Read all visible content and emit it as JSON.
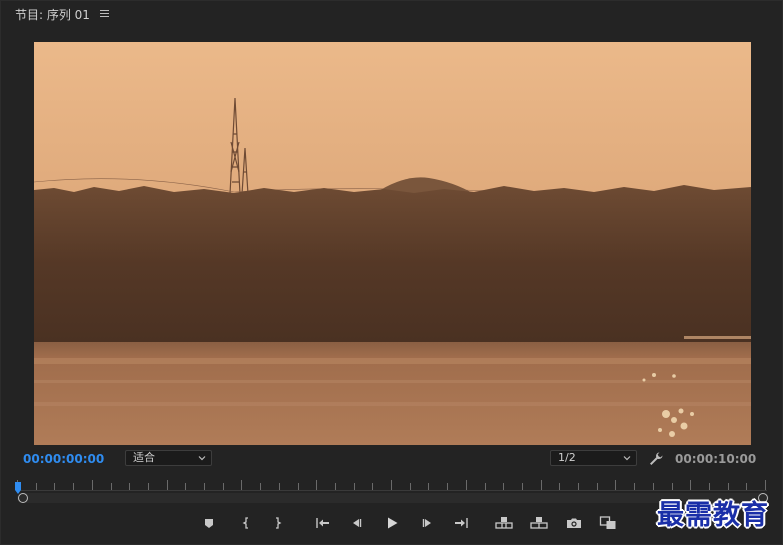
{
  "panel": {
    "title": "节目: 序列 01",
    "menu_icon": "hamburger-menu-icon"
  },
  "viewer": {
    "content": "video-frame",
    "palette": {
      "sky_top": "#e8b486",
      "sky_bottom": "#c88d63",
      "trees": "#5a3c2a",
      "water": "#a87452"
    }
  },
  "controls": {
    "current_timecode": "00:00:00:00",
    "zoom_level": "适合",
    "resolution": "1/2",
    "duration_timecode": "00:00:10:00",
    "accent_color": "#2f8cf0"
  },
  "transport": {
    "buttons": [
      {
        "name": "add-marker",
        "icon": "marker-icon"
      },
      {
        "name": "mark-in",
        "icon": "mark-in-icon"
      },
      {
        "name": "mark-out",
        "icon": "mark-out-icon"
      },
      {
        "name": "go-to-in",
        "icon": "go-to-in-icon"
      },
      {
        "name": "step-back",
        "icon": "step-back-icon"
      },
      {
        "name": "play",
        "icon": "play-icon"
      },
      {
        "name": "step-forward",
        "icon": "step-forward-icon"
      },
      {
        "name": "go-to-out",
        "icon": "go-to-out-icon"
      },
      {
        "name": "lift",
        "icon": "lift-icon"
      },
      {
        "name": "extract",
        "icon": "extract-icon"
      },
      {
        "name": "export-frame",
        "icon": "camera-icon"
      },
      {
        "name": "comparison-view",
        "icon": "comparison-icon"
      }
    ]
  },
  "watermark": {
    "text": "最需教育",
    "color": "#1a2fa8"
  }
}
